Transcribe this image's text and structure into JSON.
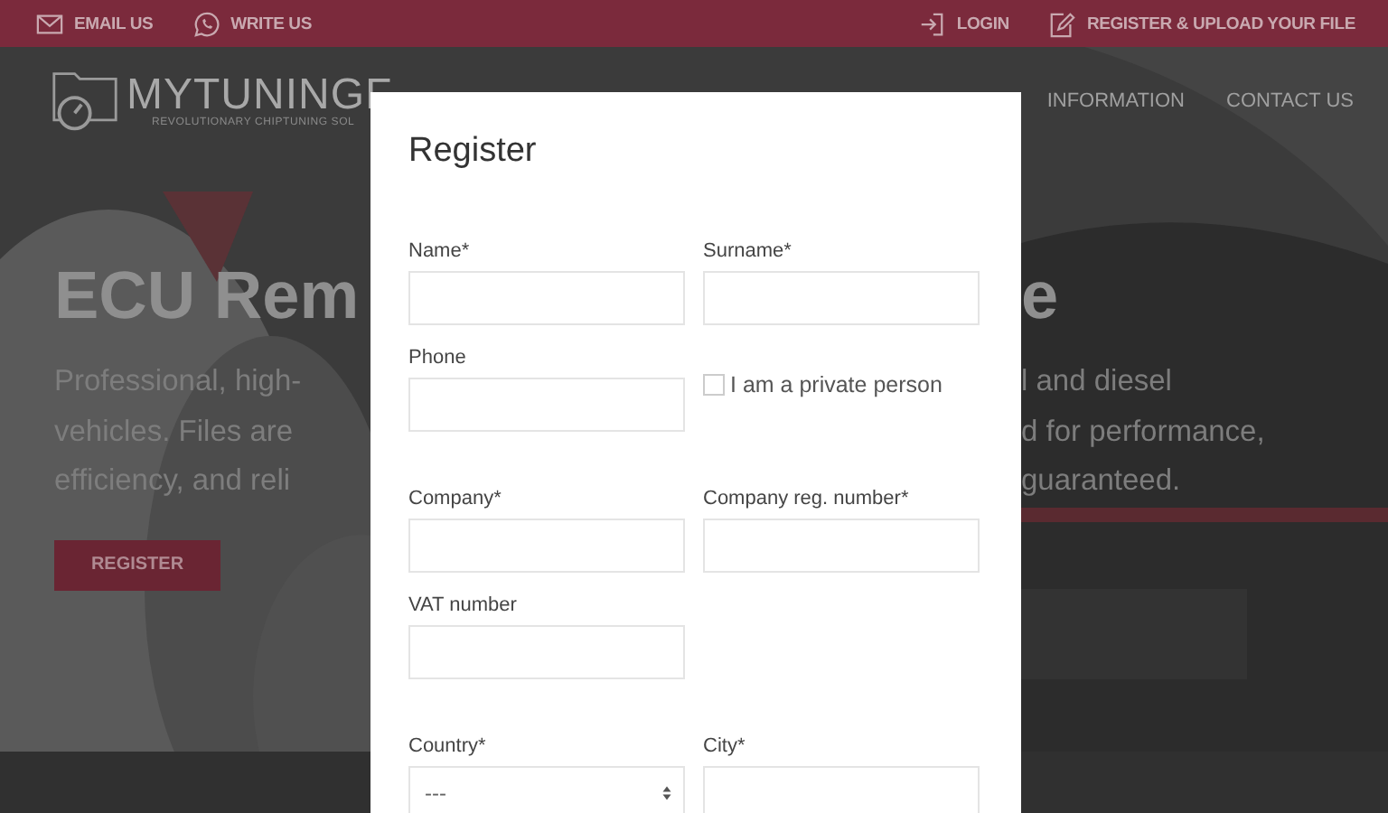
{
  "top_bar": {
    "left_links": [
      {
        "kind": "mail",
        "label": "EMAIL US"
      },
      {
        "kind": "chat",
        "label": "WRITE US"
      }
    ],
    "right_links": [
      {
        "kind": "login",
        "label": "LOGIN"
      },
      {
        "kind": "edit",
        "label": "REGISTER & UPLOAD YOUR FILE"
      }
    ]
  },
  "header": {
    "logo": {
      "name": "MYTUNINGF",
      "tagline": "REVOLUTIONARY CHIPTUNING SOL"
    },
    "nav": [
      {
        "label": "INFORMATION"
      },
      {
        "label": "CONTACT US"
      }
    ]
  },
  "hero": {
    "title_left": "ECU Rem",
    "title_right": "e",
    "paragraph_left": [
      "Professional, high-",
      "vehicles. Files are",
      "efficiency, and reli"
    ],
    "paragraph_right": [
      "l and diesel",
      "d for performance,",
      "guaranteed."
    ],
    "button": "REGISTER"
  },
  "modal": {
    "title": "Register",
    "rows": [
      {
        "fields": [
          {
            "kind": "input",
            "label": "Name*"
          },
          {
            "kind": "input",
            "label": "Surname*"
          }
        ]
      },
      {
        "fields": [
          {
            "kind": "input",
            "label": "Phone"
          },
          {
            "kind": "checkbox",
            "label": "I am a private person",
            "checked": false
          }
        ]
      },
      {
        "fields": [
          {
            "kind": "input",
            "label": "Company*"
          },
          {
            "kind": "input",
            "label": "Company reg. number*"
          }
        ]
      },
      {
        "fields": [
          {
            "kind": "input",
            "label": "VAT number"
          }
        ]
      },
      {
        "fields": [
          {
            "kind": "select",
            "label": "Country*",
            "value": "---"
          },
          {
            "kind": "input",
            "label": "City*"
          }
        ]
      }
    ]
  }
}
